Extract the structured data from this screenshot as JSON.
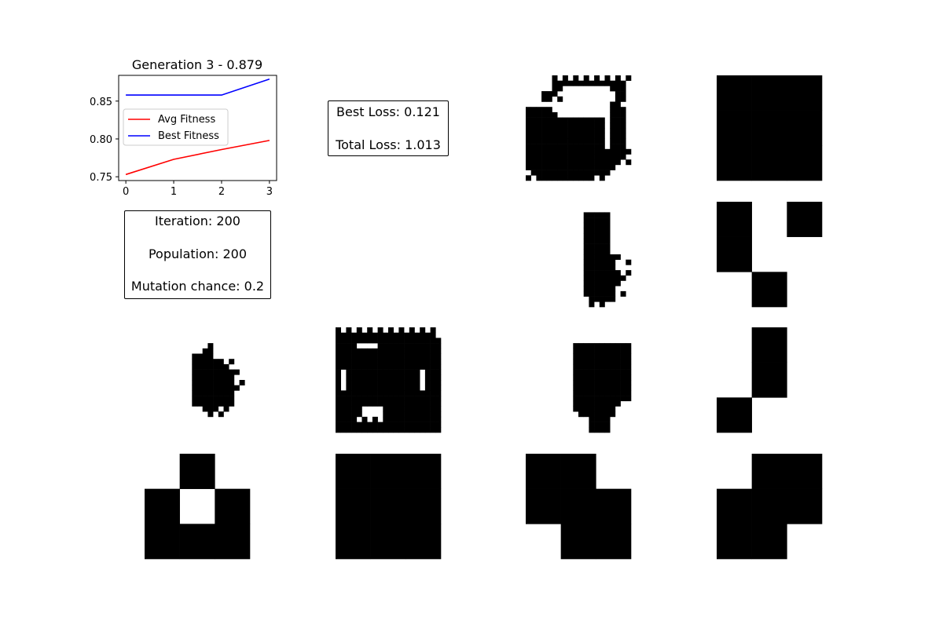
{
  "chart_data": {
    "type": "line",
    "title": "Generation 3 - 0.879",
    "x": [
      0,
      1,
      2,
      3
    ],
    "xlim": [
      -0.15,
      3.15
    ],
    "ylim": [
      0.745,
      0.884
    ],
    "xticks": [
      "0",
      "1",
      "2",
      "3"
    ],
    "yticks": [
      "0.75",
      "0.80",
      "0.85"
    ],
    "grid": false,
    "legend_position": "center-left",
    "series": [
      {
        "name": "Avg Fitness",
        "color": "#ff0000",
        "values": [
          0.753,
          0.773,
          0.786,
          0.798
        ]
      },
      {
        "name": "Best Fitness",
        "color": "#0000ff",
        "values": [
          0.858,
          0.858,
          0.858,
          0.879
        ]
      }
    ]
  },
  "info": {
    "loss": {
      "best": "Best Loss: 0.121",
      "total": "Total Loss: 1.013"
    },
    "params": {
      "iteration": "Iteration: 200",
      "population": "Population: 200",
      "mutation": "Mutation chance: 0.2"
    }
  },
  "grids": [
    {
      "rows": [
        "00000000000000000000",
        "00000000000000000000",
        "00000000000000000000",
        "00000000000000000000",
        "00000000000000000000",
        "00000000000000000000",
        "00000000000000000000",
        "00000000000000000000",
        "00000000000000000000",
        "00000000000000000000",
        "00000000000000000000",
        "00000000000000000000",
        "00000000000000000000",
        "00000000000000000000",
        "00000000000000000000",
        "00000000000000000000",
        "00000000000000000000",
        "00000000000000000000",
        "00000000000000000000",
        "00000000000000000000"
      ]
    },
    {
      "rows": [
        "00000000000000000000",
        "00000000000000000000",
        "00000000000000000000",
        "00000000000000000000",
        "00000000000000000000",
        "00000000000000000000",
        "00000000000000000000",
        "00000000000000000000",
        "00000000000000000000",
        "00000000000000000000",
        "00000000000000000000",
        "00000000000000000000",
        "00000000000000000000",
        "00000000000000000000",
        "00000000000000000000",
        "00000000000000000000",
        "00000000000000000000",
        "00000000000000000000",
        "00000000000000000000",
        "00000000000000000000"
      ]
    },
    {
      "rows": [
        "00000101010101010101",
        "00000111111111111110",
        "00000110000000001110",
        "00011100000000000110",
        "00011010000000000110",
        "00000000000000001100",
        "11111000000000001110",
        "11111100000000001110",
        "11111111111111101110",
        "11111111111111101110",
        "11111111111111101110",
        "11111111111111101110",
        "11111111111111101110",
        "11111111111111101110",
        "11111111111111111111",
        "11111111111111111110",
        "11111111111111111101",
        "11111111111111111000",
        "01111111111111110000",
        "10111111111110100000"
      ]
    },
    {
      "rows": [
        "111",
        "111",
        "111"
      ]
    },
    {
      "rows": [
        "00000000000000000000",
        "00000000000000000000",
        "00000000000000000000",
        "00000000000000000000",
        "00000000000000000000",
        "00000000000000000000",
        "00000000000000000000",
        "00000000000000000000",
        "00000000000000000000",
        "00000000000000000000",
        "00000000000000000000",
        "00000000000000000000",
        "00000000000000000000",
        "00000000000000000000",
        "00000000000000000000",
        "00000000000000000000",
        "00000000000000000000",
        "00000000000000000000",
        "00000000000000000000",
        "00000000000000000000"
      ]
    },
    {
      "rows": [
        "00000000000000000000",
        "00000000000000000000",
        "00000000000000000000",
        "00000000000000000000",
        "00000000000000000000",
        "00000000000000000000",
        "00000000000000000000",
        "00000000000000000000",
        "00000000000000000000",
        "00000000000000000000",
        "00000000000000000000",
        "00000000000000000000",
        "00000000000000000000",
        "00000000000000000000",
        "00000000000000000000",
        "00000000000000000000",
        "00000000000000000000",
        "00000000000000000000",
        "00000000000000000000",
        "00000000000000000000"
      ]
    },
    {
      "rows": [
        "00000000000000000000",
        "00000000000000000000",
        "00000000000111110000",
        "00000000000111110000",
        "00000000000111110000",
        "00000000000111110000",
        "00000000000111110000",
        "00000000000111110000",
        "00000000000111110000",
        "00000000000111110000",
        "00000000000111111100",
        "00000000000111111001",
        "00000000000111111000",
        "00000000000111111101",
        "00000000000111111110",
        "00000000000111111100",
        "00000000000111111000",
        "00000000000111111010",
        "00000000000011111000",
        "00000000000010100000"
      ]
    },
    {
      "rows": [
        "101",
        "100",
        "010"
      ]
    },
    {
      "rows": [
        "00000000000000000000",
        "00000000000000000000",
        "00000000000000000000",
        "00000000000010000000",
        "00000000000110000000",
        "00000000011110000000",
        "00000000011111101000",
        "00000000011111110000",
        "00000000011111111100",
        "00000000011111111000",
        "00000000011111111010",
        "00000000011111111100",
        "00000000011111111000",
        "00000000011111111000",
        "00000000011111111000",
        "00000000000111010000",
        "00000000000010100000",
        "00000000000000000000",
        "00000000000000000000",
        "00000000000000000000"
      ]
    },
    {
      "rows": [
        "10101010101010101010",
        "11111111111111111110",
        "11111111111111111111",
        "11110000111111111111",
        "11111111111111111111",
        "11111111111111111111",
        "11111111111111111111",
        "11111111111111111111",
        "10111111111111110111",
        "10111111111111110111",
        "10111111111111110111",
        "10111111111111110111",
        "11111111111111111111",
        "11111111111111111111",
        "11111111111111111111",
        "11111000011111111111",
        "11111000011111111111",
        "11110101011111111111",
        "11111111111111111111",
        "11111111111111111111"
      ]
    },
    {
      "rows": [
        "00000000000000000000",
        "00000000000000000000",
        "00000000000000000000",
        "00000000011111111111",
        "00000000011111111111",
        "00000000011111111111",
        "00000000011111111111",
        "00000000011111111111",
        "00000000011111111111",
        "00000000011111111111",
        "00000000011111111111",
        "00000000011111111111",
        "00000000011111111111",
        "00000000011111111111",
        "00000000011111111100",
        "00000000011111111000",
        "00000000001111111000",
        "00000000000011110000",
        "00000000000011110000",
        "00000000000011110000"
      ]
    },
    {
      "rows": [
        "010",
        "010",
        "100"
      ]
    },
    {
      "rows": [
        "010",
        "101",
        "111"
      ]
    },
    {
      "rows": [
        "111",
        "111",
        "111"
      ]
    },
    {
      "rows": [
        "110",
        "111",
        "011"
      ]
    },
    {
      "rows": [
        "011",
        "111",
        "110"
      ]
    }
  ]
}
